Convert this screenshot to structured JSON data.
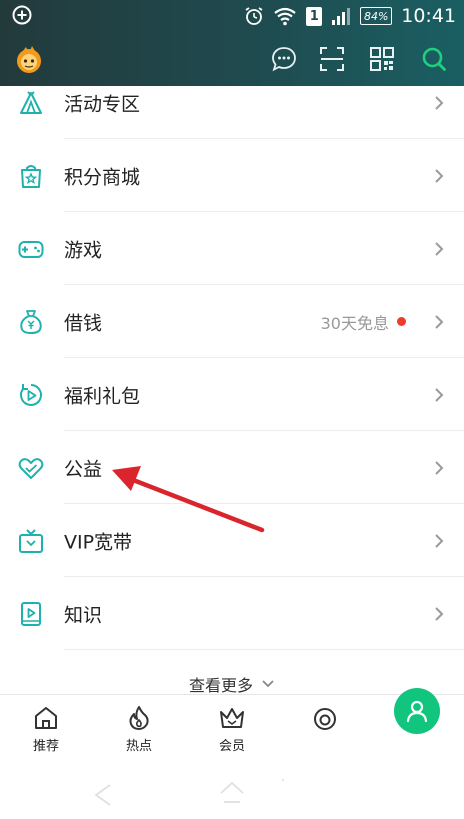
{
  "status_bar": {
    "sim_number": "1",
    "battery": "84%",
    "time": "10:41"
  },
  "header": {
    "icons": [
      "message-icon",
      "scan-icon",
      "qr-code-icon",
      "search-icon"
    ]
  },
  "menu": {
    "items": [
      {
        "label": "活动专区",
        "icon": "tent-icon"
      },
      {
        "label": "积分商城",
        "icon": "shopping-bag-icon"
      },
      {
        "label": "游戏",
        "icon": "gamepad-icon"
      },
      {
        "label": "借钱",
        "icon": "money-bag-icon",
        "note": "30天免息"
      },
      {
        "label": "福利礼包",
        "icon": "play-circle-icon"
      },
      {
        "label": "公益",
        "icon": "heart-icon"
      },
      {
        "label": "VIP宽带",
        "icon": "tv-icon"
      },
      {
        "label": "知识",
        "icon": "book-play-icon"
      }
    ],
    "more_label": "查看更多"
  },
  "bottom_nav": {
    "items": [
      {
        "label": "推荐",
        "icon": "home-icon"
      },
      {
        "label": "热点",
        "icon": "flame-icon"
      },
      {
        "label": "会员",
        "icon": "crown-icon"
      },
      {
        "label": "",
        "icon": "circle-icon"
      }
    ],
    "fab_icon": "user-icon"
  },
  "colors": {
    "accent": "#1fb1ae",
    "fab": "#12c57e",
    "badge_dot": "#ef3b2f",
    "annotation": "#d9252b"
  }
}
